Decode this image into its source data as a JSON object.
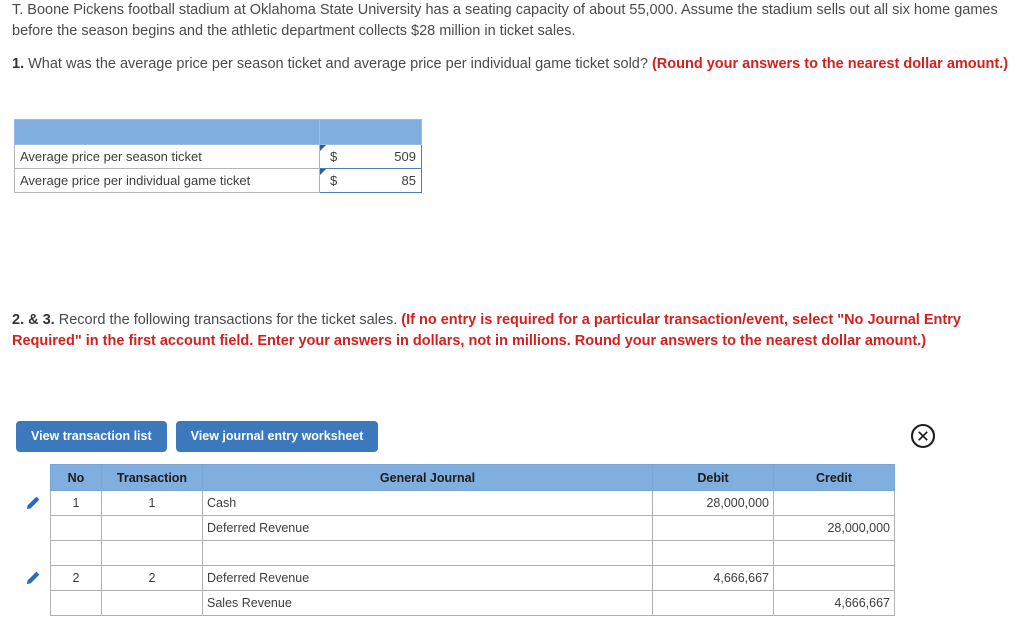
{
  "problem": {
    "intro": "T. Boone Pickens football stadium at Oklahoma State University has a seating capacity of about 55,000. Assume the stadium sells out all six home games before the season begins and the athletic department collects $28 million in ticket sales.",
    "question1": {
      "number": "1.",
      "text": " What was the average price per season ticket and average price per individual game ticket sold? ",
      "instruction": "(Round your answers to the nearest dollar amount.)"
    },
    "question23": {
      "number": "2. & 3.",
      "text": " Record the following transactions for the ticket sales. ",
      "instruction": "(If no entry is required for a particular transaction/event, select \"No Journal Entry Required\" in the first account field. Enter your answers in dollars, not in millions. Round your answers to the nearest dollar amount.)"
    }
  },
  "price_table": {
    "rows": [
      {
        "label": "Average price per season ticket",
        "currency": "$",
        "amount": "509"
      },
      {
        "label": "Average price per individual game ticket",
        "currency": "$",
        "amount": "85"
      }
    ]
  },
  "buttons": {
    "view_transaction_list": "View transaction list",
    "view_journal_entry_worksheet": "View journal entry worksheet"
  },
  "icons": {
    "close": "close-circle-icon",
    "edit": "pencil-icon"
  },
  "journal": {
    "headers": {
      "no": "No",
      "transaction": "Transaction",
      "general_journal": "General Journal",
      "debit": "Debit",
      "credit": "Credit"
    },
    "rows": [
      {
        "editable": true,
        "no": "1",
        "transaction": "1",
        "account": "Cash",
        "indent": false,
        "debit": "28,000,000",
        "credit": ""
      },
      {
        "editable": false,
        "no": "",
        "transaction": "",
        "account": "Deferred Revenue",
        "indent": true,
        "debit": "",
        "credit": "28,000,000"
      },
      {
        "editable": false,
        "no": "",
        "transaction": "",
        "account": "",
        "indent": false,
        "debit": "",
        "credit": ""
      },
      {
        "editable": true,
        "no": "2",
        "transaction": "2",
        "account": "Deferred Revenue",
        "indent": false,
        "debit": "4,666,667",
        "credit": ""
      },
      {
        "editable": false,
        "no": "",
        "transaction": "",
        "account": "Sales Revenue",
        "indent": true,
        "debit": "",
        "credit": "4,666,667"
      }
    ]
  },
  "colors": {
    "header_blue": "#80aede",
    "button_blue": "#3b78bc",
    "instruction_red": "#d32020",
    "input_border": "#4a7ebb"
  }
}
